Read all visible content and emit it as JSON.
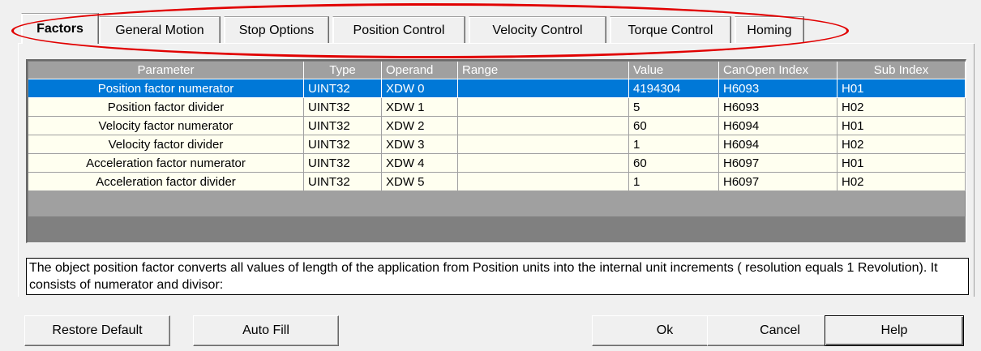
{
  "tabs": [
    {
      "label": "Factors",
      "active": true
    },
    {
      "label": "General Motion",
      "active": false
    },
    {
      "label": "Stop Options",
      "active": false
    },
    {
      "label": "Position Control",
      "active": false
    },
    {
      "label": "Velocity Control",
      "active": false
    },
    {
      "label": "Torque Control",
      "active": false
    },
    {
      "label": "Homing",
      "active": false
    }
  ],
  "grid": {
    "columns": [
      "Parameter",
      "Type",
      "Operand",
      "Range",
      "Value",
      "CanOpen Index",
      "Sub Index"
    ],
    "rows": [
      {
        "parameter": "Position factor numerator",
        "type": "UINT32",
        "operand": "XDW 0",
        "range": "",
        "value": "4194304",
        "canopen_index": "H6093",
        "sub_index": "H01",
        "selected": true
      },
      {
        "parameter": "Position factor divider",
        "type": "UINT32",
        "operand": "XDW 1",
        "range": "",
        "value": "5",
        "canopen_index": "H6093",
        "sub_index": "H02",
        "selected": false
      },
      {
        "parameter": "Velocity factor numerator",
        "type": "UINT32",
        "operand": "XDW 2",
        "range": "",
        "value": "60",
        "canopen_index": "H6094",
        "sub_index": "H01",
        "selected": false
      },
      {
        "parameter": "Velocity factor divider",
        "type": "UINT32",
        "operand": "XDW 3",
        "range": "",
        "value": "1",
        "canopen_index": "H6094",
        "sub_index": "H02",
        "selected": false
      },
      {
        "parameter": "Acceleration factor numerator",
        "type": "UINT32",
        "operand": "XDW 4",
        "range": "",
        "value": "60",
        "canopen_index": "H6097",
        "sub_index": "H01",
        "selected": false
      },
      {
        "parameter": "Acceleration factor divider",
        "type": "UINT32",
        "operand": "XDW 5",
        "range": "",
        "value": "1",
        "canopen_index": "H6097",
        "sub_index": "H02",
        "selected": false
      }
    ]
  },
  "description": "The object position factor converts all values of length of the application from Position units into the internal unit increments ( resolution equals 1 Revolution). It consists of numerator and divisor:",
  "buttons": {
    "restore_default": "Restore Default",
    "auto_fill": "Auto Fill",
    "ok": "Ok",
    "cancel": "Cancel",
    "help": "Help"
  },
  "colors": {
    "selection": "#0078d7",
    "row_background": "#fffff0",
    "header_background": "#a0a0a0",
    "annotation": "#e10000"
  }
}
